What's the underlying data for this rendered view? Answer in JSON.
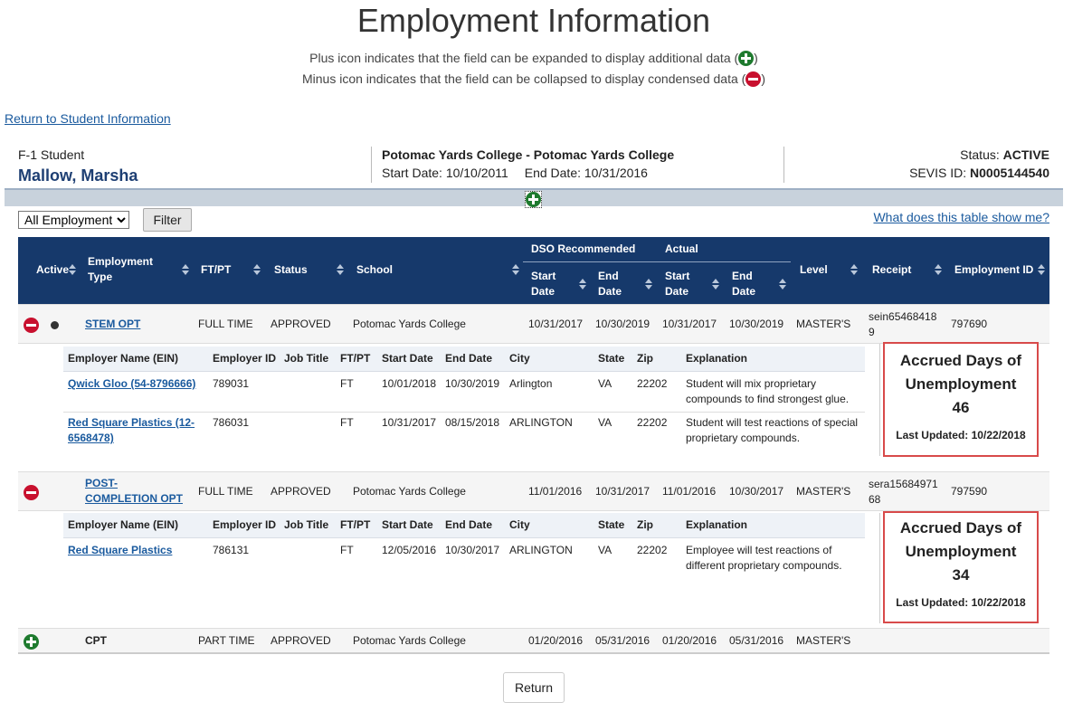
{
  "page": {
    "title": "Employment Information",
    "legend_plus": "Plus icon indicates that the field can be expanded to display additional data (",
    "legend_minus": "Minus icon indicates that the field can be collapsed to display condensed data (",
    "legend_close": ")",
    "return_link": "Return to Student Information"
  },
  "student": {
    "type": "F-1 Student",
    "name": "Mallow, Marsha",
    "school": "Potomac Yards College - Potomac Yards College",
    "start_label": "Start Date:",
    "start_date": "10/10/2011",
    "end_label": "End Date:",
    "end_date": "10/31/2016",
    "status_label": "Status:",
    "status": "ACTIVE",
    "sevis_label": "SEVIS ID:",
    "sevis_id": "N0005144540"
  },
  "filter": {
    "selected": "All Employment",
    "button": "Filter",
    "help": "What does this table show me?"
  },
  "table_header": {
    "active": "Active",
    "employment_type_1": "Employment",
    "employment_type_2": "Type",
    "ftpt": "FT/PT",
    "status": "Status",
    "school": "School",
    "dso": "DSO Recommended",
    "actual": "Actual",
    "start_1": "Start",
    "start_2": "Date",
    "end_1": "End",
    "end_2": "Date",
    "level": "Level",
    "receipt": "Receipt",
    "employment_id": "Employment ID"
  },
  "sub_header": {
    "employer_name": "Employer Name (EIN)",
    "employer_id": "Employer ID",
    "job_title": "Job Title",
    "ftpt": "FT/PT",
    "start": "Start Date",
    "end": "End Date",
    "city": "City",
    "state": "State",
    "zip": "Zip",
    "explanation": "Explanation"
  },
  "rows": [
    {
      "type": "STEM OPT",
      "ftpt": "FULL TIME",
      "status": "APPROVED",
      "school": "Potomac Yards College",
      "dso_start": "10/31/2017",
      "dso_end": "10/30/2019",
      "act_start": "10/31/2017",
      "act_end": "10/30/2019",
      "level": "MASTER'S",
      "receipt_1": "sein65468418",
      "receipt_2": "9",
      "employment_id": "797690",
      "employers": [
        {
          "name_1": "Qwick Gloo (54-8796666)",
          "employer_id": "789031",
          "job_title": "",
          "ftpt": "FT",
          "start": "10/01/2018",
          "end": "10/30/2019",
          "city": "Arlington",
          "state": "VA",
          "zip": "22202",
          "expl_1": "Student will mix proprietary",
          "expl_2": "compounds to find strongest glue."
        },
        {
          "name_1": "Red Square Plastics (12-",
          "name_2": "6568478)",
          "employer_id": "786031",
          "job_title": "",
          "ftpt": "FT",
          "start": "10/31/2017",
          "end": "08/15/2018",
          "city": "ARLINGTON",
          "state": "VA",
          "zip": "22202",
          "expl_1": "Student will test reactions of special",
          "expl_2": "proprietary compounds."
        }
      ],
      "accrued": {
        "title_1": "Accrued Days of",
        "title_2": "Unemployment",
        "days": "46",
        "updated": "Last Updated: 10/22/2018"
      }
    },
    {
      "type_1": "POST-",
      "type_2": "COMPLETION OPT",
      "ftpt": "FULL TIME",
      "status": "APPROVED",
      "school": "Potomac Yards College",
      "dso_start": "11/01/2016",
      "dso_end": "10/31/2017",
      "act_start": "11/01/2016",
      "act_end": "10/30/2017",
      "level": "MASTER'S",
      "receipt_1": "sera15684971",
      "receipt_2": "68",
      "employment_id": "797590",
      "employers": [
        {
          "name_1": "Red Square Plastics",
          "employer_id": "786131",
          "job_title": "",
          "ftpt": "FT",
          "start": "12/05/2016",
          "end": "10/30/2017",
          "city": "ARLINGTON",
          "state": "VA",
          "zip": "22202",
          "expl_1": "Employee will test reactions of",
          "expl_2": "different proprietary compounds."
        }
      ],
      "accrued": {
        "title_1": "Accrued Days of",
        "title_2": "Unemployment",
        "days": "34",
        "updated": "Last Updated: 10/22/2018"
      }
    },
    {
      "type": "CPT",
      "ftpt": "PART TIME",
      "status": "APPROVED",
      "school": "Potomac Yards College",
      "dso_start": "01/20/2016",
      "dso_end": "05/31/2016",
      "act_start": "01/20/2016",
      "act_end": "05/31/2016",
      "level": "MASTER'S"
    }
  ],
  "footer": {
    "return_button": "Return"
  },
  "colors": {
    "header_bg": "#16396b",
    "name": "#1e3f73",
    "link": "#1a5a9e",
    "accrued_border": "#d84a4a"
  }
}
